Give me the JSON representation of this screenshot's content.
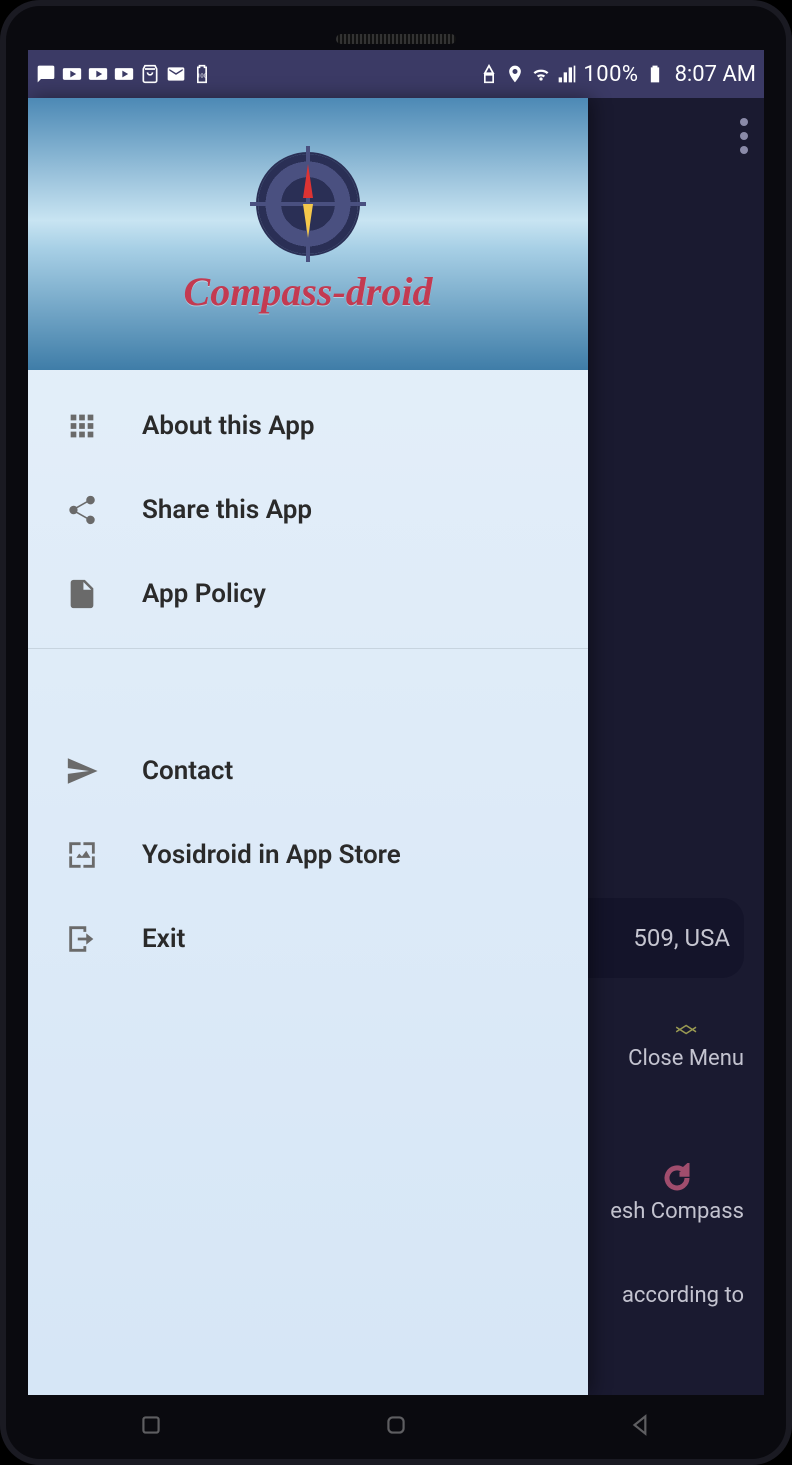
{
  "statusbar": {
    "battery_pct": "100%",
    "time": "8:07 AM"
  },
  "drawer": {
    "app_title": "Compass-droid",
    "items_top": [
      {
        "icon": "apps-icon",
        "label": "About this App"
      },
      {
        "icon": "share-icon",
        "label": "Share this App"
      },
      {
        "icon": "file-icon",
        "label": "App Policy"
      }
    ],
    "items_bottom": [
      {
        "icon": "send-icon",
        "label": "Contact"
      },
      {
        "icon": "wallpaper-icon",
        "label": "Yosidroid in App Store"
      },
      {
        "icon": "exit-icon",
        "label": "Exit"
      }
    ]
  },
  "background": {
    "address_fragment": "509, USA",
    "close_menu_label": "Close Menu",
    "refresh_label": "esh Compass",
    "according_fragment": "according to"
  }
}
